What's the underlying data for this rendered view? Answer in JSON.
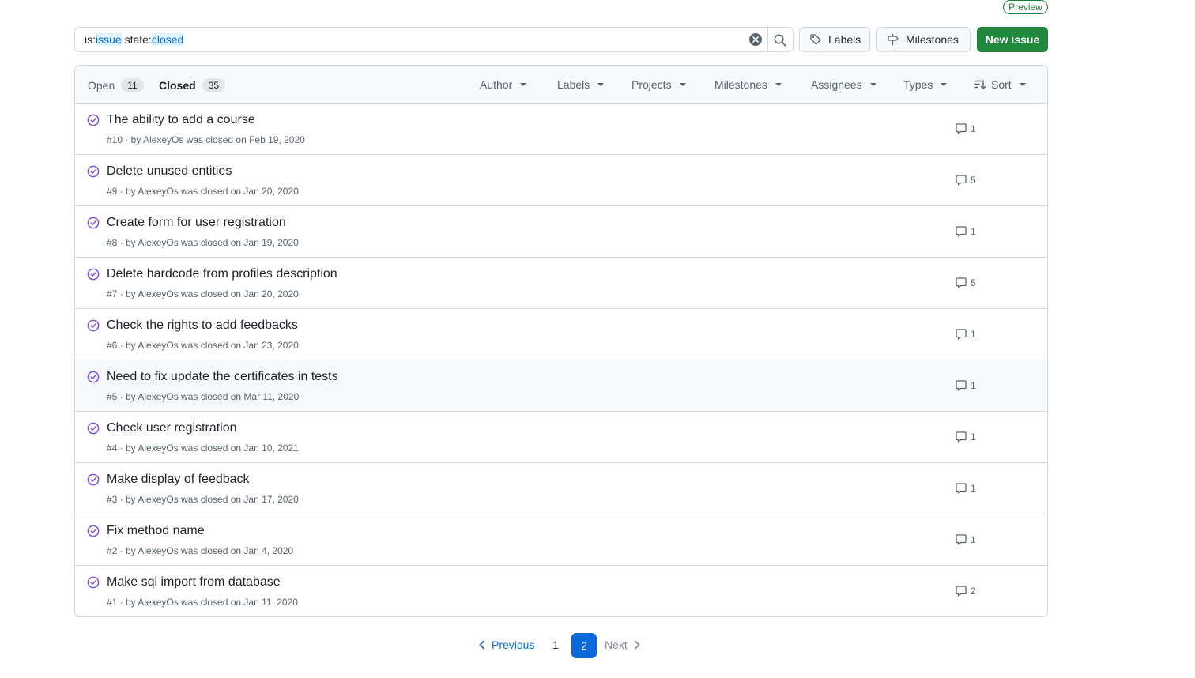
{
  "preview_badge": "Preview",
  "search": {
    "tokens": [
      {
        "text": "is:",
        "highlight": false
      },
      {
        "text": "issue",
        "highlight": true
      },
      {
        "text": " state:",
        "highlight": false
      },
      {
        "text": "closed",
        "highlight": true
      }
    ]
  },
  "toolbar": {
    "labels_label": "Labels",
    "milestones_label": "Milestones",
    "new_issue_label": "New issue"
  },
  "tabs": {
    "open_label": "Open",
    "open_count": "11",
    "closed_label": "Closed",
    "closed_count": "35"
  },
  "filters": {
    "author": "Author",
    "labels": "Labels",
    "projects": "Projects",
    "milestones": "Milestones",
    "assignees": "Assignees",
    "types": "Types",
    "sort": "Sort"
  },
  "issues": [
    {
      "title": "The ability to add a course",
      "meta": "#10 · by AlexeyOs was closed on Feb 19, 2020",
      "comments": "1"
    },
    {
      "title": "Delete unused entities",
      "meta": "#9 · by AlexeyOs was closed on Jan 20, 2020",
      "comments": "5"
    },
    {
      "title": "Create form for user registration",
      "meta": "#8 · by AlexeyOs was closed on Jan 19, 2020",
      "comments": "1"
    },
    {
      "title": "Delete hardcode from profiles description",
      "meta": "#7 · by AlexeyOs was closed on Jan 20, 2020",
      "comments": "5"
    },
    {
      "title": "Check the rights to add feedbacks",
      "meta": "#6 · by AlexeyOs was closed on Jan 23, 2020",
      "comments": "1"
    },
    {
      "title": "Need to fix update the certificates in tests",
      "meta": "#5 · by AlexeyOs was closed on Mar 11, 2020",
      "comments": "1"
    },
    {
      "title": "Check user registration",
      "meta": "#4 · by AlexeyOs was closed on Jan 10, 2021",
      "comments": "1"
    },
    {
      "title": "Make display of feedback",
      "meta": "#3 · by AlexeyOs was closed on Jan 17, 2020",
      "comments": "1"
    },
    {
      "title": "Fix method name",
      "meta": "#2 · by AlexeyOs was closed on Jan 4, 2020",
      "comments": "1"
    },
    {
      "title": "Make sql import from database",
      "meta": "#1 · by AlexeyOs was closed on Jan 11, 2020",
      "comments": "2"
    }
  ],
  "pagination": {
    "previous": "Previous",
    "pages": [
      "1",
      "2"
    ],
    "current": "2",
    "next": "Next"
  },
  "colors": {
    "closed_issue_icon": "#8250df",
    "primary_button": "#1f883d",
    "link": "#0969da"
  }
}
